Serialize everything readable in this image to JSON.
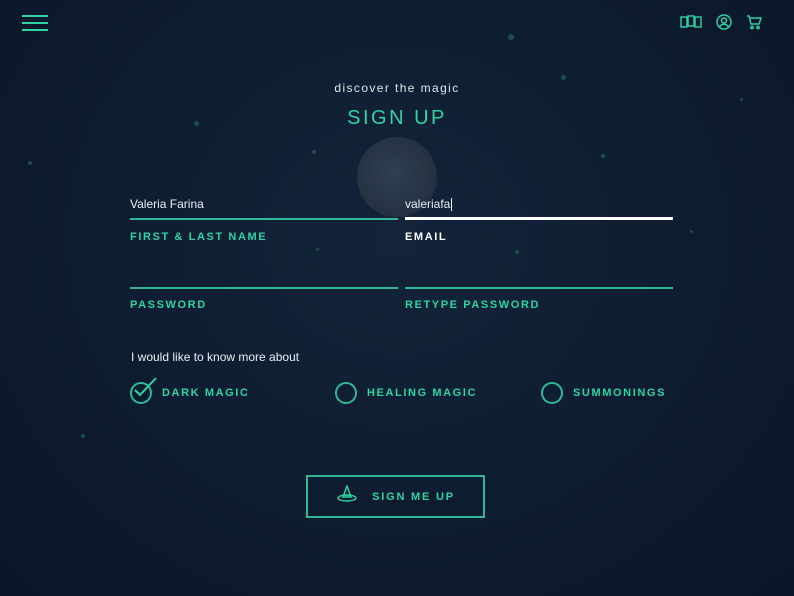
{
  "header": {
    "menu_icon": "hamburger-menu-icon",
    "icons": [
      "cards-icon",
      "user-account-icon",
      "shopping-cart-icon"
    ]
  },
  "hero": {
    "subtitle": "discover the magic",
    "title": "SIGN UP"
  },
  "form": {
    "name": {
      "value": "Valeria Farina",
      "label": "FIRST & LAST NAME"
    },
    "email": {
      "value": "valeriafa",
      "label": "EMAIL",
      "focused": true
    },
    "password": {
      "value": "",
      "label": "PASSWORD"
    },
    "retype_password": {
      "value": "",
      "label": "RETYPE PASSWORD"
    }
  },
  "interests": {
    "prompt": "I would like to know more about",
    "options": [
      {
        "label": "DARK MAGIC",
        "checked": true
      },
      {
        "label": "HEALING MAGIC",
        "checked": false
      },
      {
        "label": "SUMMONINGS",
        "checked": false
      }
    ]
  },
  "submit": {
    "label": "SIGN ME UP",
    "icon": "witch-hat-icon"
  },
  "colors": {
    "background": "#0e1c30",
    "accent": "#2fd4a3",
    "text": "#e8eef2"
  }
}
